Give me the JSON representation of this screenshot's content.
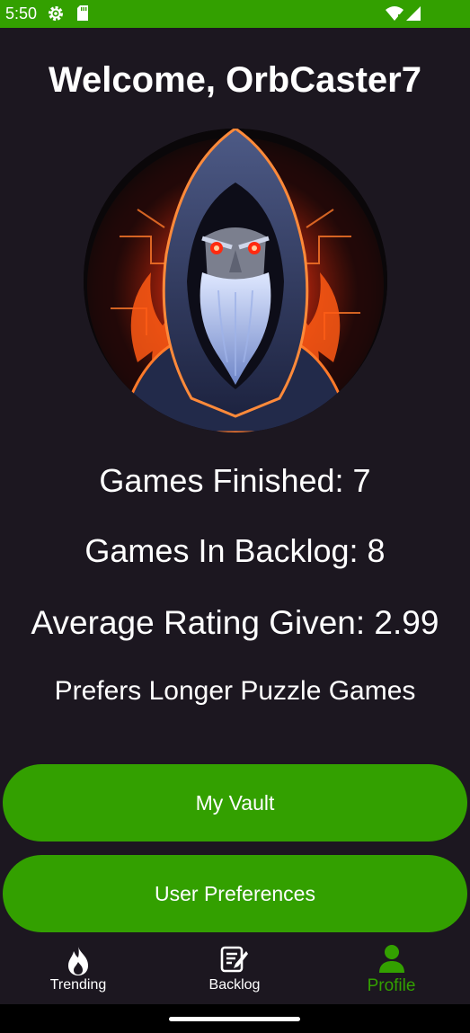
{
  "status_bar": {
    "time": "5:50",
    "icons": [
      "settings-gear-icon",
      "sd-card-icon",
      "wifi-icon",
      "signal-icon"
    ]
  },
  "profile": {
    "welcome": "Welcome, OrbCaster7",
    "avatar": "hooded-wizard-avatar",
    "games_finished": "Games Finished: 7",
    "games_in_backlog": "Games In Backlog: 8",
    "average_rating": "Average Rating Given: 2.99",
    "preference": "Prefers Longer Puzzle Games"
  },
  "actions": {
    "my_vault": "My Vault",
    "user_preferences": "User Preferences"
  },
  "bottom_nav": {
    "items": [
      {
        "label": "Trending",
        "icon": "flame-icon",
        "active": false
      },
      {
        "label": "Backlog",
        "icon": "edit-list-icon",
        "active": false
      },
      {
        "label": "Profile",
        "icon": "person-icon",
        "active": true
      }
    ]
  },
  "colors": {
    "accent": "#33a000",
    "background": "#1c1720",
    "text": "#ffffff"
  }
}
